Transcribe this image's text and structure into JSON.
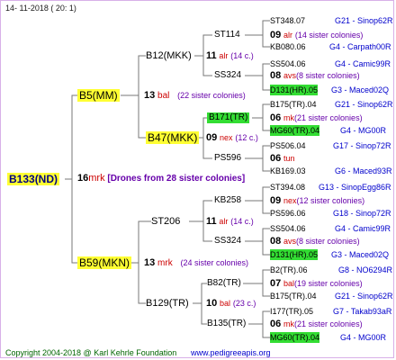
{
  "header": {
    "date": "14- 11-2018 ( 20: 1)"
  },
  "root": {
    "name": "B133(ND)",
    "num": "16",
    "abbr": "mrk",
    "note": "[Drones from 28 sister colonies]"
  },
  "g1": [
    {
      "name": "B5(MM)",
      "num": "13",
      "abbr": "bal",
      "note": "(22 sister colonies)"
    },
    {
      "name": "B59(MKN)",
      "num": "13",
      "abbr": "mrk",
      "note": "(24 sister colonies)"
    }
  ],
  "g2": [
    {
      "name": "B12(MKK)",
      "num": "11",
      "abbr": "alr",
      "note": "(14 c.)"
    },
    {
      "name": "B47(MKK)",
      "num": "09",
      "abbr": "nex",
      "note": "(12 c.)"
    },
    {
      "name": "ST206",
      "num": "11",
      "abbr": "alr",
      "note": "(14 c.)"
    },
    {
      "name": "B129(TR)",
      "num": "10",
      "abbr": "bal",
      "note": "(23 c.)"
    }
  ],
  "g3": [
    {
      "name": "ST114",
      "num": "09",
      "abbr": "alr",
      "note": "(14 sister colonies)"
    },
    {
      "name": "SS324",
      "num": "08",
      "abbr": "avs",
      "note": "(8 sister colonies)"
    },
    {
      "name": "B171(TR)",
      "num": "06",
      "abbr": "mk",
      "note": "(21 sister colonies)"
    },
    {
      "name": "PS596",
      "num": "06",
      "abbr": "tun",
      "note": ""
    },
    {
      "name": "KB258",
      "num": "09",
      "abbr": "nex",
      "note": "(12 sister colonies)"
    },
    {
      "name": "SS324",
      "num": "08",
      "abbr": "avs",
      "note": "(8 sister colonies)"
    },
    {
      "name": "B82(TR)",
      "num": "07",
      "abbr": "bal",
      "note": "(19 sister colonies)"
    },
    {
      "name": "B135(TR)",
      "num": "06",
      "abbr": "mk",
      "note": "(21 sister colonies)"
    }
  ],
  "g4": [
    {
      "name": "ST348.07",
      "loc": "G21 - Sinop62R"
    },
    {
      "name": "KB080.06",
      "loc": "G4 - Carpath00R"
    },
    {
      "name": "SS504.06",
      "loc": "G4 - Camic99R"
    },
    {
      "name": "D131(HR).05",
      "loc": "G3 - Maced02Q"
    },
    {
      "name": "B175(TR).04",
      "loc": "G21 - Sinop62R"
    },
    {
      "name": "MG60(TR).04",
      "loc": "G4 - MG00R"
    },
    {
      "name": "PS506.04",
      "loc": "G17 - Sinop72R"
    },
    {
      "name": "KB169.03",
      "loc": "G6 - Maced93R"
    },
    {
      "name": "ST394.08",
      "loc": "G13 - SinopEgg86R"
    },
    {
      "name": "PS596.06",
      "loc": "G18 - Sinop72R"
    },
    {
      "name": "SS504.06",
      "loc": "G4 - Camic99R"
    },
    {
      "name": "D131(HR).05",
      "loc": "G3 - Maced02Q"
    },
    {
      "name": "B2(TR).06",
      "loc": "G8 - NO6294R"
    },
    {
      "name": "B175(TR).04",
      "loc": "G21 - Sinop62R"
    },
    {
      "name": "I177(TR).05",
      "loc": "G7 - Takab93aR"
    },
    {
      "name": "MG60(TR).04",
      "loc": "G4 - MG00R"
    }
  ],
  "footer": {
    "copyright": "Copyright 2004-2018 @ Karl Kehrle Foundation",
    "url": "www.pedigreeapis.org"
  },
  "colors": {
    "yellow": "#ffff33",
    "green": "#33dd33",
    "red": "#cc0000",
    "purple": "#6600aa",
    "blue": "#0000cc",
    "lines": "#777777"
  }
}
